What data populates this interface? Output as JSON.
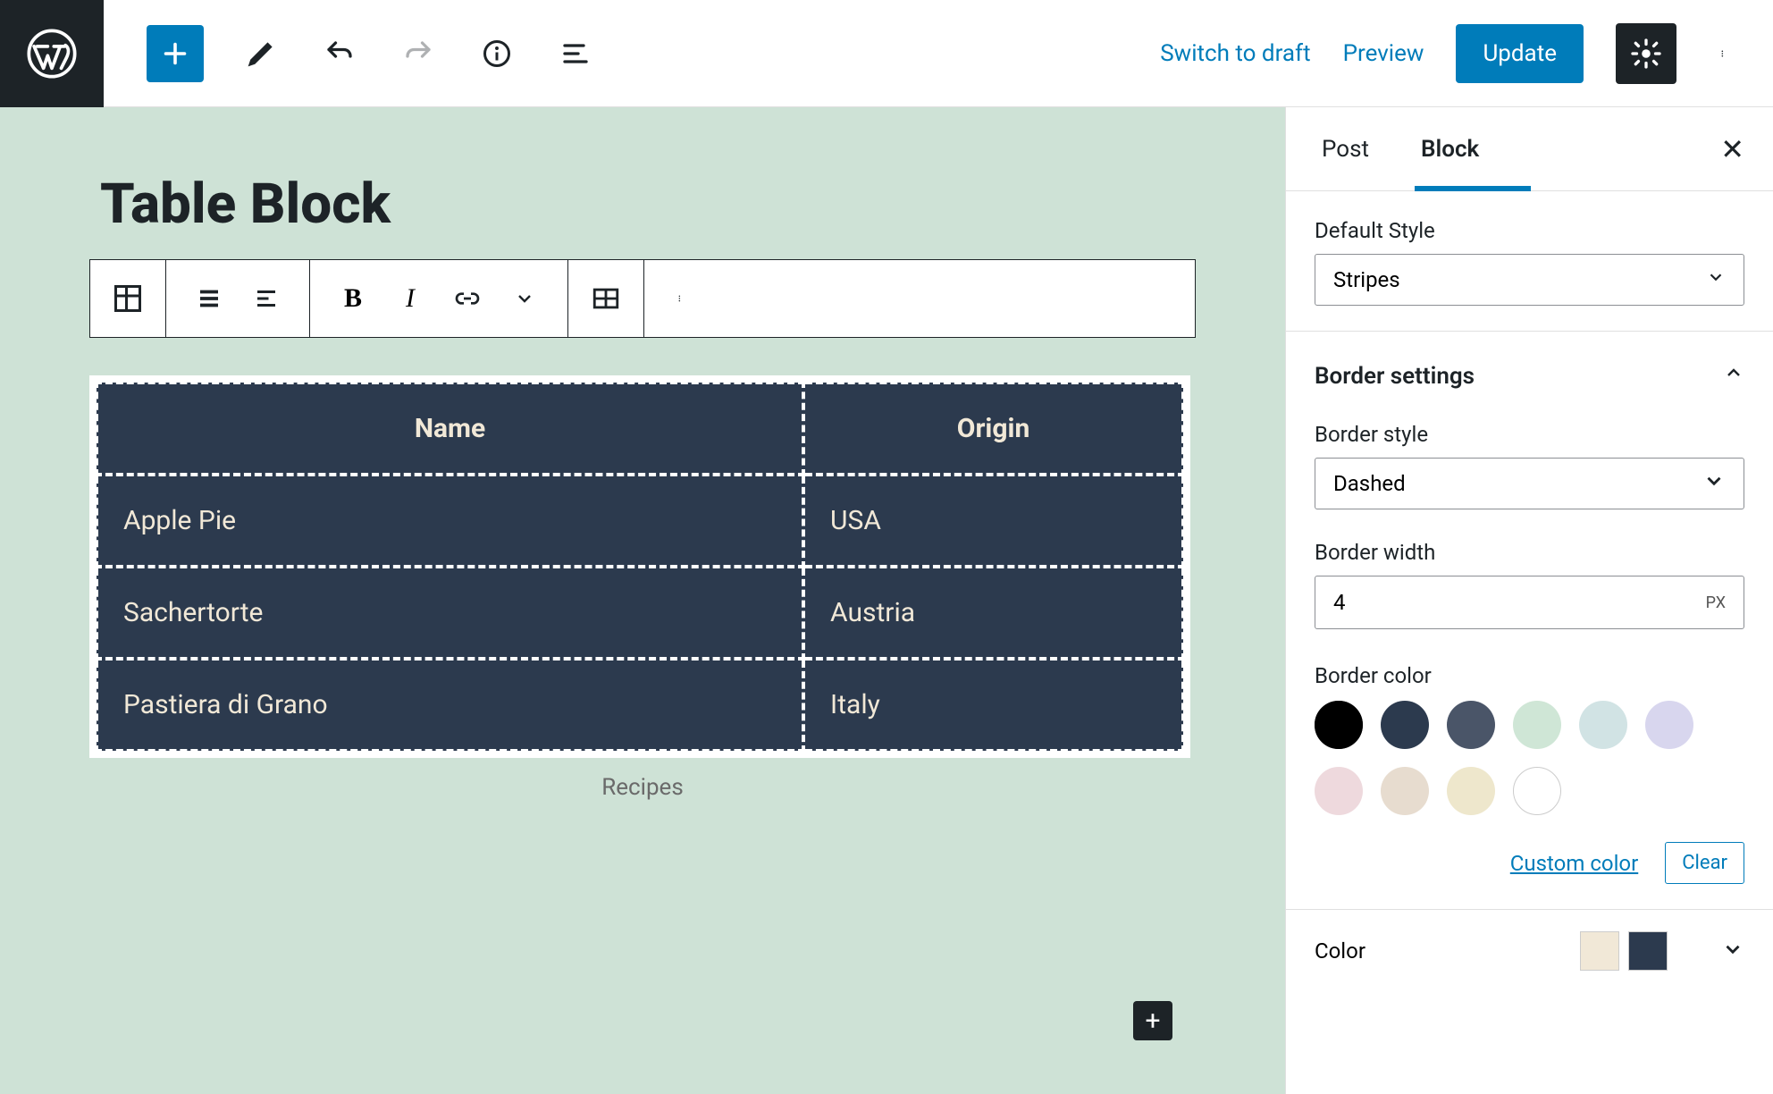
{
  "topbar": {
    "switch_to_draft": "Switch to draft",
    "preview": "Preview",
    "update": "Update"
  },
  "post_title_peek": "Table Block",
  "sidebar": {
    "tabs": {
      "post": "Post",
      "block": "Block"
    },
    "default_style": {
      "label": "Default Style",
      "value": "Stripes"
    },
    "border_settings": {
      "title": "Border settings",
      "style": {
        "label": "Border style",
        "value": "Dashed"
      },
      "width": {
        "label": "Border width",
        "value": "4",
        "unit": "PX"
      },
      "color": {
        "label": "Border color",
        "swatches": [
          "#000000",
          "#2c3a4e",
          "#4a5568",
          "#cfe6d6",
          "#d1e3e4",
          "#d8d6ee",
          "#eed9dd",
          "#e7dccf",
          "#eee7cc",
          "#ffffff"
        ],
        "selected": "#000000",
        "custom": "Custom color",
        "clear": "Clear"
      }
    },
    "color_section": {
      "title": "Color",
      "chips": [
        "#f1e8d7",
        "#2c3a4e"
      ]
    }
  },
  "table": {
    "headers": [
      "Name",
      "Origin"
    ],
    "rows": [
      [
        "Apple Pie",
        "USA"
      ],
      [
        "Sachertorte",
        "Austria"
      ],
      [
        "Pastiera di Grano",
        "Italy"
      ]
    ],
    "caption": "Recipes"
  }
}
